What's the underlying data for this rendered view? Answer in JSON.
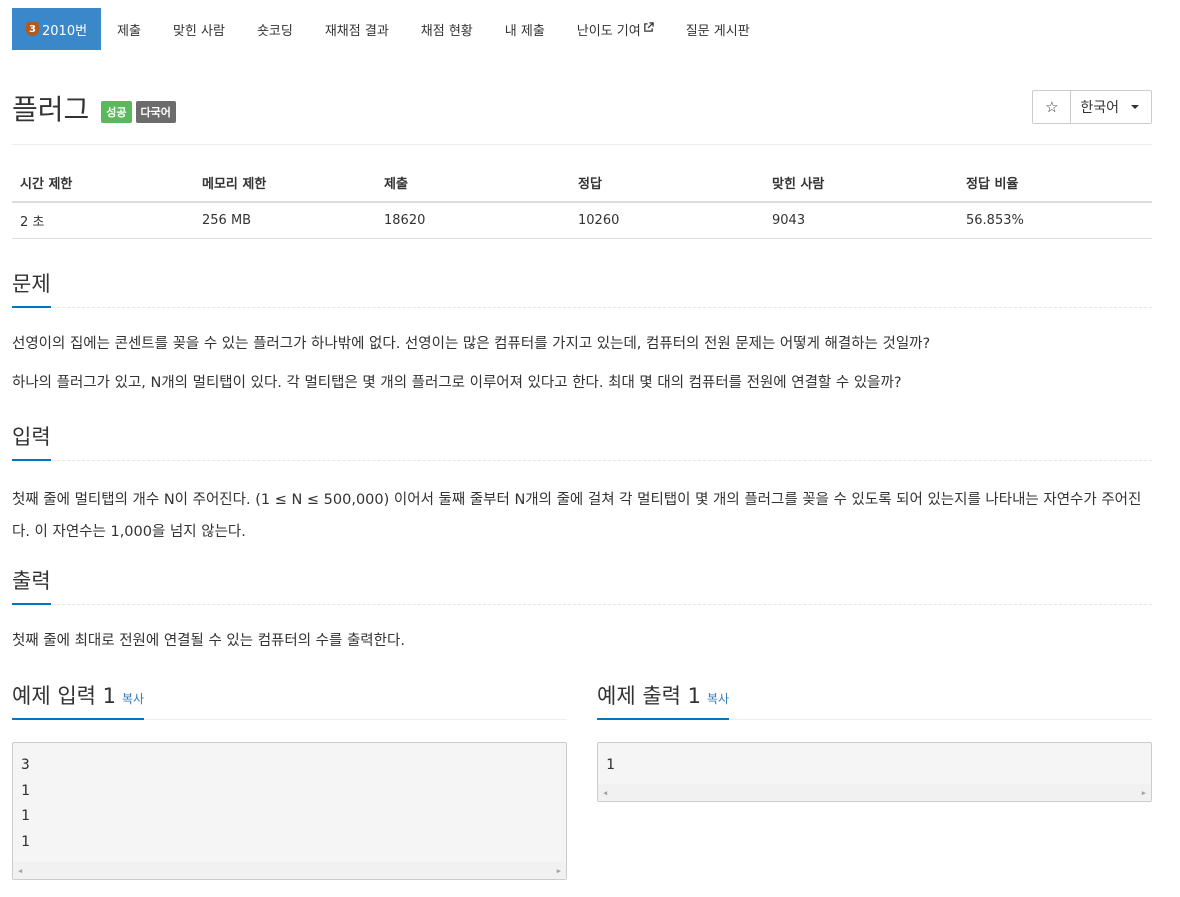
{
  "nav": {
    "problem": {
      "tier": "3",
      "label": "2010번"
    },
    "items": [
      "제출",
      "맞힌 사람",
      "숏코딩",
      "재채점 결과",
      "채점 현황",
      "내 제출",
      "난이도 기여",
      "질문 게시판"
    ]
  },
  "problem": {
    "title": "플러그",
    "badges": {
      "solved": "성공",
      "multilang": "다국어"
    },
    "star_icon": "☆",
    "language": "한국어"
  },
  "info": {
    "headers": [
      "시간 제한",
      "메모리 제한",
      "제출",
      "정답",
      "맞힌 사람",
      "정답 비율"
    ],
    "values": [
      "2 초",
      "256 MB",
      "18620",
      "10260",
      "9043",
      "56.853%"
    ]
  },
  "sections": {
    "description": {
      "title": "문제",
      "paragraphs": [
        "선영이의 집에는 콘센트를 꽂을 수 있는 플러그가 하나밖에 없다. 선영이는 많은 컴퓨터를 가지고 있는데, 컴퓨터의 전원 문제는 어떻게 해결하는 것일까?",
        "하나의 플러그가 있고, N개의 멀티탭이 있다. 각 멀티탭은 몇 개의 플러그로 이루어져 있다고 한다. 최대 몇 대의 컴퓨터를 전원에 연결할 수 있을까?"
      ]
    },
    "input": {
      "title": "입력",
      "text": "첫째 줄에 멀티탭의 개수 N이 주어진다. (1 ≤ N ≤ 500,000) 이어서 둘째 줄부터 N개의 줄에 걸쳐 각 멀티탭이 몇 개의 플러그를 꽂을 수 있도록 되어 있는지를 나타내는 자연수가 주어진다. 이 자연수는 1,000을 넘지 않는다."
    },
    "output": {
      "title": "출력",
      "text": "첫째 줄에 최대로 전원에 연결될 수 있는 컴퓨터의 수를 출력한다."
    }
  },
  "samples": {
    "input_title": "예제 입력 1",
    "output_title": "예제 출력 1",
    "copy_label": "복사",
    "input_lines": [
      "3",
      "1",
      "1",
      "1"
    ],
    "output_lines": [
      "1"
    ],
    "scroll_left": "◀",
    "scroll_right": "▶"
  },
  "colors": {
    "active_tab": "#3a87c9",
    "accent": "#0076c0",
    "success": "#5cb85c"
  }
}
